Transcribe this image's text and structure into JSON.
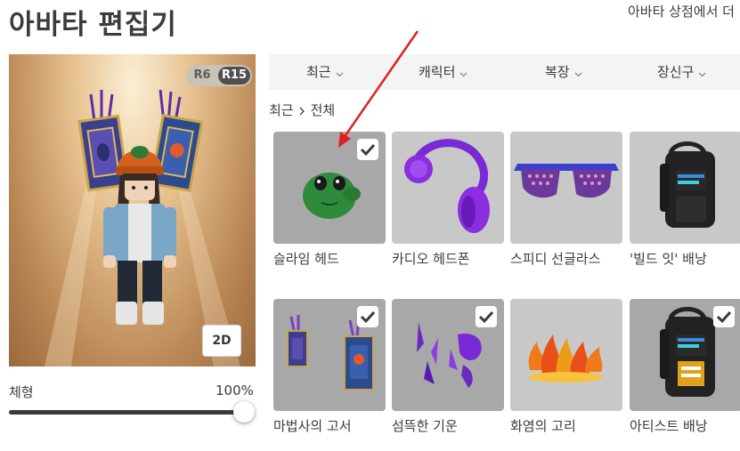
{
  "header": {
    "title": "아바타 편집기",
    "shop_link": "아바타 상점에서 더"
  },
  "preview": {
    "rig_options": [
      "R6",
      "R15"
    ],
    "rig_selected": "R15",
    "view_toggle": "2D",
    "body_label": "체형",
    "body_value": "100%",
    "body_scale_fraction": 1.0
  },
  "categories": [
    {
      "label": "최근"
    },
    {
      "label": "캐릭터"
    },
    {
      "label": "복장"
    },
    {
      "label": "장신구"
    }
  ],
  "breadcrumb": {
    "parent": "최근",
    "current": "전체"
  },
  "items": [
    {
      "name": "슬라임 헤드",
      "selected": true
    },
    {
      "name": "카디오 헤드폰",
      "selected": false
    },
    {
      "name": "스피디 선글라스",
      "selected": false
    },
    {
      "name": "'빌드 잇' 배낭",
      "selected": false
    },
    {
      "name": "마법사의 고서",
      "selected": true
    },
    {
      "name": "섬뜩한 기운",
      "selected": true
    },
    {
      "name": "화염의 고리",
      "selected": false
    },
    {
      "name": "아티스트 배낭",
      "selected": true
    }
  ],
  "colors": {
    "accent_text": "#393b3d",
    "annotation_arrow": "#e02020",
    "tile_bg": "#c8c8c8"
  }
}
